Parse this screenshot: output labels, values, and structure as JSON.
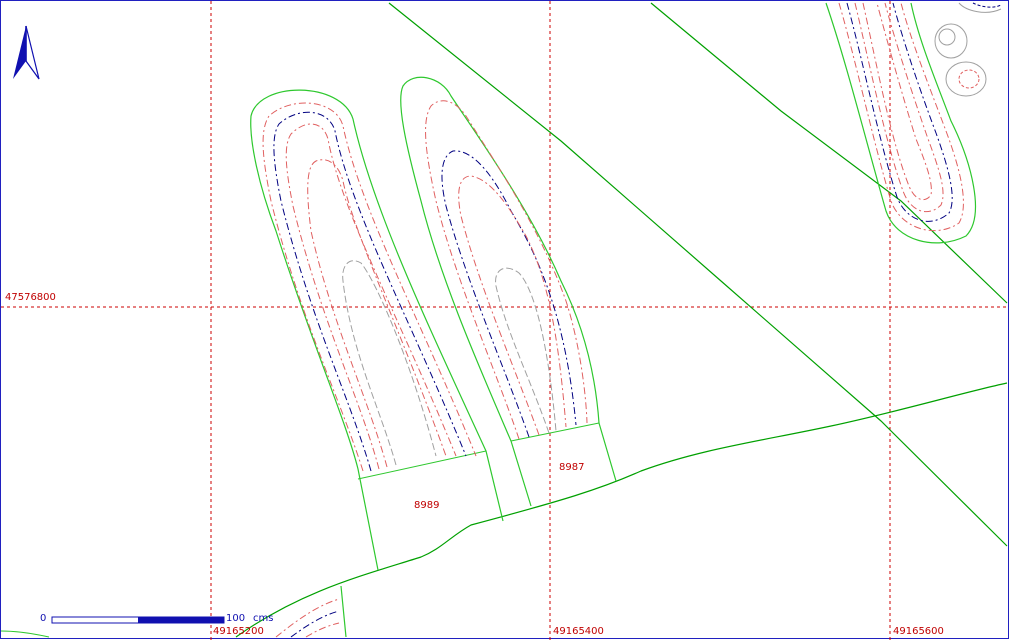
{
  "map": {
    "colors": {
      "grid": "#cc0000",
      "label": "#c00000",
      "boundary": "#00a000",
      "contour_red": "#e06060",
      "contour_blue": "#000080",
      "contour_gray": "#a0a0a0",
      "frame": "#2020c0",
      "north_arrow": "#1010b0"
    },
    "north_arrow": {
      "icon": "north-arrow-icon"
    },
    "grid": {
      "northing_label": "47576800",
      "easting_labels": [
        "49165200",
        "49165400",
        "49165600"
      ]
    },
    "parcels": [
      {
        "id": "8989"
      },
      {
        "id": "8987"
      }
    ],
    "scale_bar": {
      "start": "0",
      "end": "100",
      "unit": "cms"
    }
  }
}
